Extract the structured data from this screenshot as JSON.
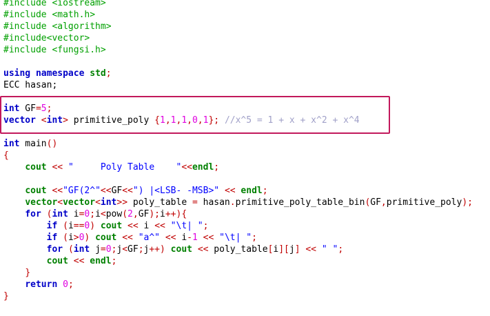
{
  "lines": [
    [
      [
        "pre",
        "#include <iostream>"
      ]
    ],
    [
      [
        "pre",
        "#include <math.h>"
      ]
    ],
    [
      [
        "pre",
        "#include <algorithm>"
      ]
    ],
    [
      [
        "pre",
        "#include<vector>"
      ]
    ],
    [
      [
        "pre",
        "#include <fungsi.h>"
      ]
    ],
    [],
    [
      [
        "kw",
        "using"
      ],
      [
        "id",
        " "
      ],
      [
        "kw",
        "namespace"
      ],
      [
        "id",
        " "
      ],
      [
        "std",
        "std"
      ],
      [
        "op",
        ";"
      ]
    ],
    [
      [
        "id",
        "ECC hasan;"
      ]
    ],
    [],
    [
      [
        "type",
        "int"
      ],
      [
        "id",
        " GF"
      ],
      [
        "op",
        "="
      ],
      [
        "num",
        "5"
      ],
      [
        "op",
        ";"
      ]
    ],
    [
      [
        "type",
        "vector"
      ],
      [
        "id",
        " "
      ],
      [
        "op",
        "<"
      ],
      [
        "type",
        "int"
      ],
      [
        "op",
        ">"
      ],
      [
        "id",
        " primitive_poly "
      ],
      [
        "op",
        "{"
      ],
      [
        "num",
        "1"
      ],
      [
        "op",
        ","
      ],
      [
        "num",
        "1"
      ],
      [
        "op",
        ","
      ],
      [
        "num",
        "1"
      ],
      [
        "op",
        ","
      ],
      [
        "num",
        "0"
      ],
      [
        "op",
        ","
      ],
      [
        "num",
        "1"
      ],
      [
        "op",
        "};"
      ],
      [
        "id",
        " "
      ],
      [
        "cmt",
        "//x^5 = 1 + x + x^2 + x^4"
      ]
    ],
    [],
    [
      [
        "type",
        "int"
      ],
      [
        "id",
        " main"
      ],
      [
        "op",
        "()"
      ]
    ],
    [
      [
        "op",
        "{"
      ]
    ],
    [
      [
        "id",
        "    "
      ],
      [
        "std",
        "cout"
      ],
      [
        "id",
        " "
      ],
      [
        "op",
        "<<"
      ],
      [
        "id",
        " "
      ],
      [
        "str",
        "\"     Poly Table    \""
      ],
      [
        "op",
        "<<"
      ],
      [
        "std",
        "endl"
      ],
      [
        "op",
        ";"
      ]
    ],
    [],
    [
      [
        "id",
        "    "
      ],
      [
        "std",
        "cout"
      ],
      [
        "id",
        " "
      ],
      [
        "op",
        "<<"
      ],
      [
        "str",
        "\"GF(2^\""
      ],
      [
        "op",
        "<<"
      ],
      [
        "id",
        "GF"
      ],
      [
        "op",
        "<<"
      ],
      [
        "str",
        "\") |<LSB- -MSB>\""
      ],
      [
        "id",
        " "
      ],
      [
        "op",
        "<<"
      ],
      [
        "id",
        " "
      ],
      [
        "std",
        "endl"
      ],
      [
        "op",
        ";"
      ]
    ],
    [
      [
        "id",
        "    "
      ],
      [
        "std",
        "vector"
      ],
      [
        "op",
        "<"
      ],
      [
        "std",
        "vector"
      ],
      [
        "op",
        "<"
      ],
      [
        "type",
        "int"
      ],
      [
        "op",
        ">>"
      ],
      [
        "id",
        " poly_table "
      ],
      [
        "op",
        "="
      ],
      [
        "id",
        " hasan"
      ],
      [
        "op",
        "."
      ],
      [
        "id",
        "primitive_poly_table_bin"
      ],
      [
        "op",
        "("
      ],
      [
        "id",
        "GF"
      ],
      [
        "op",
        ","
      ],
      [
        "id",
        "primitive_poly"
      ],
      [
        "op",
        ");"
      ]
    ],
    [
      [
        "id",
        "    "
      ],
      [
        "kw",
        "for"
      ],
      [
        "id",
        " "
      ],
      [
        "op",
        "("
      ],
      [
        "type",
        "int"
      ],
      [
        "id",
        " i"
      ],
      [
        "op",
        "="
      ],
      [
        "num",
        "0"
      ],
      [
        "op",
        ";"
      ],
      [
        "id",
        "i"
      ],
      [
        "op",
        "<"
      ],
      [
        "id",
        "pow"
      ],
      [
        "op",
        "("
      ],
      [
        "num",
        "2"
      ],
      [
        "op",
        ","
      ],
      [
        "id",
        "GF"
      ],
      [
        "op",
        ");"
      ],
      [
        "id",
        "i"
      ],
      [
        "op",
        "++){"
      ]
    ],
    [
      [
        "id",
        "        "
      ],
      [
        "kw",
        "if"
      ],
      [
        "id",
        " "
      ],
      [
        "op",
        "("
      ],
      [
        "id",
        "i"
      ],
      [
        "op",
        "=="
      ],
      [
        "num",
        "0"
      ],
      [
        "op",
        ")"
      ],
      [
        "id",
        " "
      ],
      [
        "std",
        "cout"
      ],
      [
        "id",
        " "
      ],
      [
        "op",
        "<<"
      ],
      [
        "id",
        " i "
      ],
      [
        "op",
        "<<"
      ],
      [
        "id",
        " "
      ],
      [
        "str",
        "\"\\t| \""
      ],
      [
        "op",
        ";"
      ]
    ],
    [
      [
        "id",
        "        "
      ],
      [
        "kw",
        "if"
      ],
      [
        "id",
        " "
      ],
      [
        "op",
        "("
      ],
      [
        "id",
        "i"
      ],
      [
        "op",
        ">"
      ],
      [
        "num",
        "0"
      ],
      [
        "op",
        ")"
      ],
      [
        "id",
        " "
      ],
      [
        "std",
        "cout"
      ],
      [
        "id",
        " "
      ],
      [
        "op",
        "<<"
      ],
      [
        "id",
        " "
      ],
      [
        "str",
        "\"a^\""
      ],
      [
        "id",
        " "
      ],
      [
        "op",
        "<<"
      ],
      [
        "id",
        " i"
      ],
      [
        "op",
        "-"
      ],
      [
        "num",
        "1"
      ],
      [
        "id",
        " "
      ],
      [
        "op",
        "<<"
      ],
      [
        "id",
        " "
      ],
      [
        "str",
        "\"\\t| \""
      ],
      [
        "op",
        ";"
      ]
    ],
    [
      [
        "id",
        "        "
      ],
      [
        "kw",
        "for"
      ],
      [
        "id",
        " "
      ],
      [
        "op",
        "("
      ],
      [
        "type",
        "int"
      ],
      [
        "id",
        " j"
      ],
      [
        "op",
        "="
      ],
      [
        "num",
        "0"
      ],
      [
        "op",
        ";"
      ],
      [
        "id",
        "j"
      ],
      [
        "op",
        "<"
      ],
      [
        "id",
        "GF"
      ],
      [
        "op",
        ";"
      ],
      [
        "id",
        "j"
      ],
      [
        "op",
        "++)"
      ],
      [
        "id",
        " "
      ],
      [
        "std",
        "cout"
      ],
      [
        "id",
        " "
      ],
      [
        "op",
        "<<"
      ],
      [
        "id",
        " poly_table"
      ],
      [
        "op",
        "["
      ],
      [
        "id",
        "i"
      ],
      [
        "op",
        "]["
      ],
      [
        "id",
        "j"
      ],
      [
        "op",
        "]"
      ],
      [
        "id",
        " "
      ],
      [
        "op",
        "<<"
      ],
      [
        "id",
        " "
      ],
      [
        "str",
        "\" \""
      ],
      [
        "op",
        ";"
      ]
    ],
    [
      [
        "id",
        "        "
      ],
      [
        "std",
        "cout"
      ],
      [
        "id",
        " "
      ],
      [
        "op",
        "<<"
      ],
      [
        "id",
        " "
      ],
      [
        "std",
        "endl"
      ],
      [
        "op",
        ";"
      ]
    ],
    [
      [
        "id",
        "    "
      ],
      [
        "op",
        "}"
      ]
    ],
    [
      [
        "id",
        "    "
      ],
      [
        "kw",
        "return"
      ],
      [
        "id",
        " "
      ],
      [
        "num",
        "0"
      ],
      [
        "op",
        ";"
      ]
    ],
    [
      [
        "op",
        "}"
      ]
    ]
  ],
  "gutter_lines": [
    13,
    18,
    23,
    25
  ],
  "colors": {
    "keyword": "#0000c8",
    "preprocessor": "#00a000",
    "number": "#e000e0",
    "string": "#0000ff",
    "operator": "#c00000",
    "std": "#008000",
    "comment": "#a0a0c8",
    "highlight_box": "#c2185b"
  }
}
